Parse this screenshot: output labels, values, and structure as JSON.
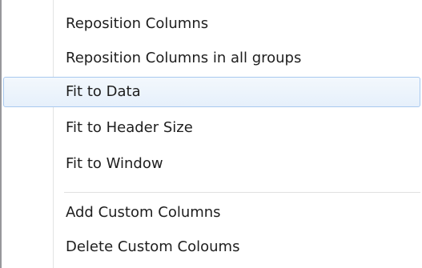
{
  "context_menu": {
    "items": [
      {
        "label": "Reposition Columns"
      },
      {
        "label": "Reposition Columns in all groups"
      },
      {
        "label": "Fit to Data",
        "highlighted": true
      },
      {
        "label": "Fit to Header Size"
      },
      {
        "label": "Fit to Window"
      },
      {
        "label": "Add Custom Columns"
      },
      {
        "label": "Delete Custom Coloums"
      }
    ]
  }
}
